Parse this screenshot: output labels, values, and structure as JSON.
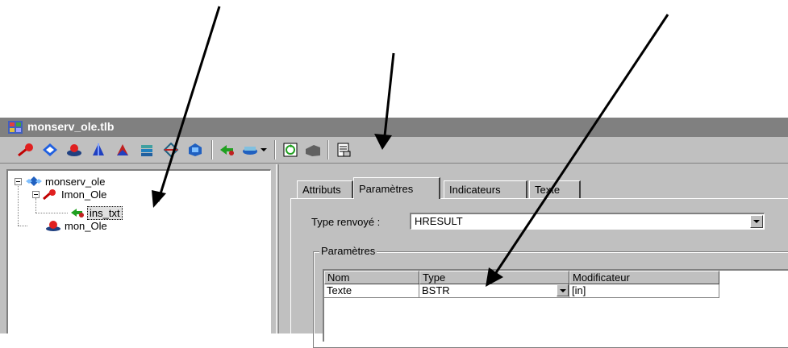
{
  "window": {
    "title": "monserv_ole.tlb"
  },
  "toolbar": {
    "icons": [
      "pin-icon",
      "diamond-icon",
      "object-icon",
      "cone-icon",
      "shape-icon",
      "stack-icon",
      "arrows-icon",
      "cube-icon",
      "green-arrow-icon",
      "link-icon",
      "dropdown-icon",
      "refresh-icon",
      "module-icon",
      "document-icon"
    ]
  },
  "tree": {
    "root": "monserv_ole",
    "interface": "Imon_Ole",
    "method": "ins_txt",
    "coclass": "mon_Ole"
  },
  "tabs": [
    "Attributs",
    "Paramètres",
    "Indicateurs",
    "Texte"
  ],
  "active_tab": "Paramètres",
  "return_type": {
    "label": "Type renvoyé :",
    "value": "HRESULT"
  },
  "params_group": {
    "label": "Paramètres",
    "columns": [
      "Nom",
      "Type",
      "Modificateur"
    ],
    "rows": [
      {
        "name": "Texte",
        "type": "BSTR",
        "modifier": "[in]"
      }
    ]
  },
  "colors": {
    "window_bg": "#c0c0c0",
    "titlebar": "#808080",
    "selection": "#e0e0e0"
  }
}
